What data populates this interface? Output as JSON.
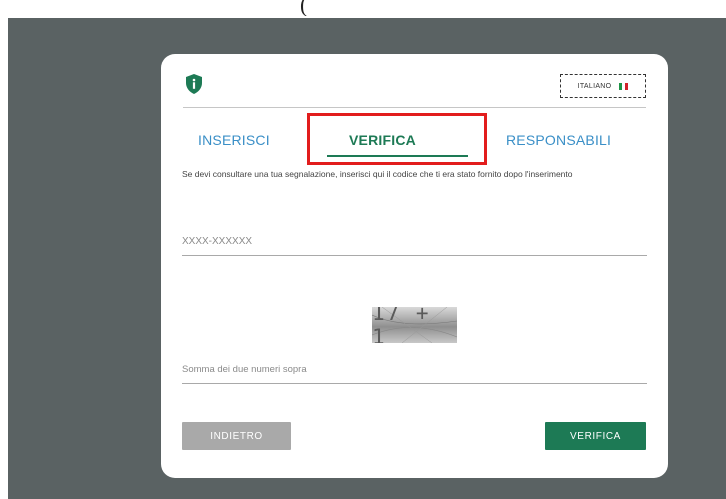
{
  "header": {
    "partial_title": "(                          "
  },
  "language": {
    "label": "ITALIANO",
    "flag_colors": [
      "#1e9447",
      "#ffffff",
      "#d2232a"
    ]
  },
  "tabs": [
    {
      "label": "INSERISCI",
      "active": false
    },
    {
      "label": "VERIFICA",
      "active": true
    },
    {
      "label": "RESPONSABILI",
      "active": false
    }
  ],
  "description": "Se devi consultare una tua segnalazione, inserisci qui il codice che ti era stato fornito dopo l'inserimento",
  "code_field": {
    "placeholder": "XXXX-XXXXXX",
    "value": ""
  },
  "captcha": {
    "text": "17 + 1"
  },
  "sum_field": {
    "placeholder": "Somma dei due numeri sopra",
    "value": ""
  },
  "buttons": {
    "back": "INDIETRO",
    "verify": "VERIFICA"
  },
  "colors": {
    "accent_green": "#1d7a55",
    "tab_blue": "#3a8fc7",
    "highlight_red": "#e21d1d",
    "background": "#5a6263"
  }
}
